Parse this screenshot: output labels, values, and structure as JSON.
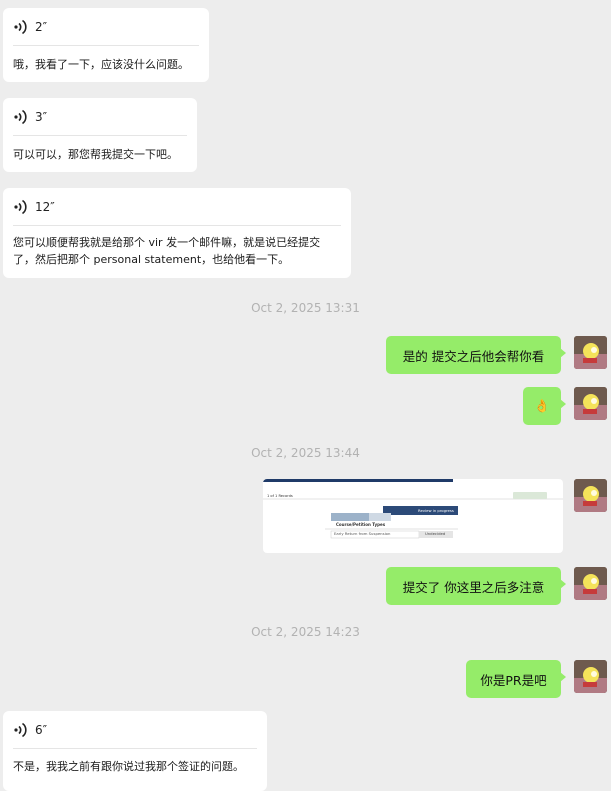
{
  "messages_in": [
    {
      "duration": "2″",
      "text": "哦，我看了一下，应该没什么问题。"
    },
    {
      "duration": "3″",
      "text": "可以可以，那您帮我提交一下吧。"
    },
    {
      "duration": "12″",
      "text": "您可以顺便帮我就是给那个 vir 发一个邮件嘛，就是说已经提交\n了，然后把那个 personal statement，也给他看一下。"
    },
    {
      "duration": "6″",
      "text": "不是，我我之前有跟你说过我那个签证的问题。"
    }
  ],
  "timestamps": [
    "Oct 2, 2025 13:31",
    "Oct 2, 2025 13:44",
    "Oct 2, 2025 14:23"
  ],
  "messages_out": [
    {
      "text": "是的 提交之后他会帮你看"
    },
    {
      "text": "👌"
    },
    {
      "text": "提交了 你这里之后多注意"
    },
    {
      "text": "你是PR是吧"
    }
  ],
  "image_msg": {
    "records": "1 of 1 Records",
    "status": "Review in progress",
    "section_title": "Course/Petition Types",
    "row_label": "Early Return from Suspension",
    "row_status": "Undecided"
  },
  "colors": {
    "background": "#ededed",
    "outgoing_bubble": "#95ec69",
    "incoming_bubble": "#ffffff",
    "timestamp": "#b2b2b2"
  }
}
